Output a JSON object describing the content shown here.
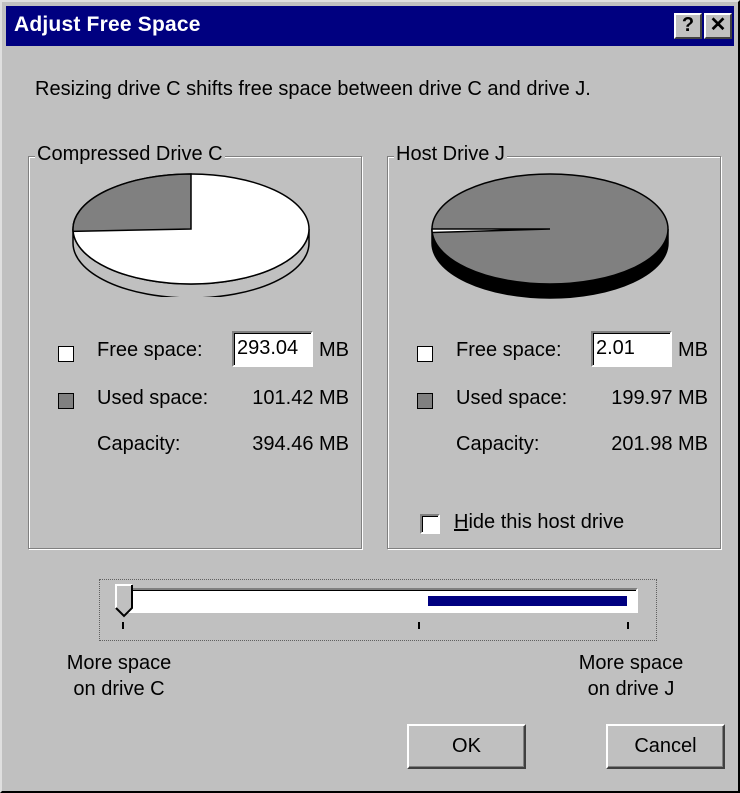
{
  "window": {
    "title": "Adjust Free Space",
    "help_glyph": "?",
    "close_glyph": "✕"
  },
  "description": "Resizing drive C shifts free space between drive C and drive J.",
  "drive_c": {
    "group_title": "Compressed Drive C",
    "free_label": "Free space:",
    "free_value": "293.04",
    "free_unit": "MB",
    "used_label": "Used space:",
    "used_value": "101.42 MB",
    "capacity_label": "Capacity:",
    "capacity_value": "394.46 MB",
    "used_fraction": 0.257
  },
  "drive_j": {
    "group_title": "Host Drive J",
    "free_label": "Free space:",
    "free_value": "2.01",
    "free_unit": "MB",
    "used_label": "Used space:",
    "used_value": "199.97 MB",
    "capacity_label": "Capacity:",
    "capacity_value": "201.98 MB",
    "used_fraction": 0.99,
    "hide_checkbox_prefix": "H",
    "hide_checkbox_rest": "ide this host drive",
    "hide_checked": false
  },
  "slider": {
    "left_label_line1": "More space",
    "left_label_line2": "on drive C",
    "right_label_line1": "More space",
    "right_label_line2": "on drive J",
    "position_fraction": 0.0,
    "highlight_start_fraction": 0.6,
    "highlight_end_fraction": 0.99
  },
  "buttons": {
    "ok": "OK",
    "cancel": "Cancel"
  },
  "colors": {
    "title_bar": "#000080",
    "face": "#c0c0c0",
    "free_swatch": "#ffffff",
    "used_swatch": "#808080",
    "slider_fill": "#000080"
  }
}
